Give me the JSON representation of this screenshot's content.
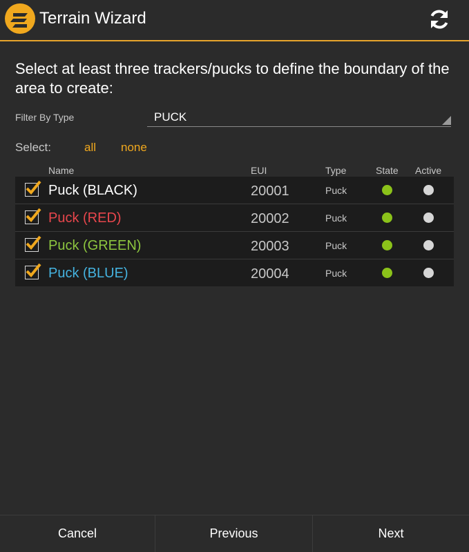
{
  "app": {
    "title": "Terrain Wizard",
    "logo_icon": "terrain-logo-icon",
    "refresh_icon": "refresh-icon",
    "accent_color": "#f0a81e"
  },
  "main": {
    "instruction": "Select at least three trackers/pucks to define the boundary of the area to create:",
    "filter": {
      "label": "Filter By Type",
      "value": "PUCK"
    },
    "select": {
      "label": "Select:",
      "all": "all",
      "none": "none"
    }
  },
  "table": {
    "headers": {
      "name": "Name",
      "eui": "EUI",
      "type": "Type",
      "state": "State",
      "active": "Active"
    },
    "rows": [
      {
        "checked": true,
        "name": "Puck (BLACK)",
        "name_color": "#ffffff",
        "eui": "20001",
        "type": "Puck",
        "state_color": "#8bc21a",
        "active_color": "#d6d6d6"
      },
      {
        "checked": true,
        "name": "Puck (RED)",
        "name_color": "#e8464c",
        "eui": "20002",
        "type": "Puck",
        "state_color": "#8bc21a",
        "active_color": "#d6d6d6"
      },
      {
        "checked": true,
        "name": "Puck (GREEN)",
        "name_color": "#8dc63f",
        "eui": "20003",
        "type": "Puck",
        "state_color": "#8bc21a",
        "active_color": "#d6d6d6"
      },
      {
        "checked": true,
        "name": "Puck (BLUE)",
        "name_color": "#45b3e0",
        "eui": "20004",
        "type": "Puck",
        "state_color": "#8bc21a",
        "active_color": "#d6d6d6"
      }
    ]
  },
  "footer": {
    "cancel": "Cancel",
    "previous": "Previous",
    "next": "Next"
  }
}
